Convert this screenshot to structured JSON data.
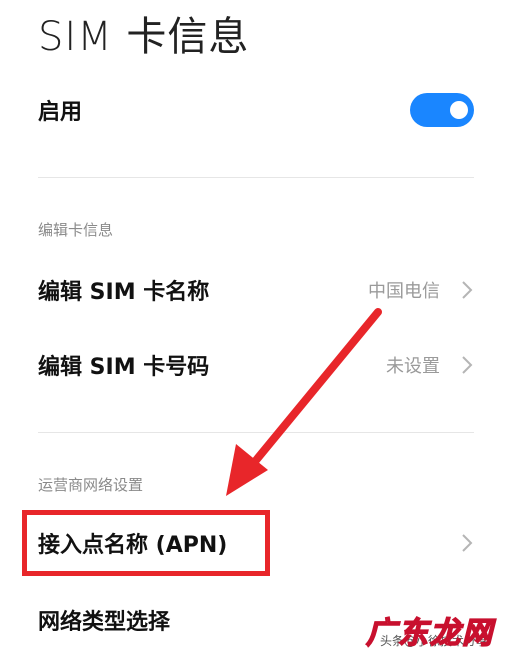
{
  "page": {
    "title": "SIM 卡信息"
  },
  "enable_row": {
    "label": "启用",
    "toggle_on": true
  },
  "sections": {
    "edit_card_info": {
      "header": "编辑卡信息",
      "items": [
        {
          "label": "编辑 SIM 卡名称",
          "value": "中国电信"
        },
        {
          "label": "编辑 SIM 卡号码",
          "value": "未设置"
        }
      ]
    },
    "carrier_network": {
      "header": "运营商网络设置",
      "items": [
        {
          "label": "接入点名称 (APN)"
        },
        {
          "label": "网络类型选择"
        }
      ]
    }
  },
  "watermark": {
    "brand": "广东龙网",
    "sub": "头条@小徐技术分享"
  },
  "colors": {
    "accent": "#1a86ff",
    "annotation_red": "#e8262a"
  }
}
